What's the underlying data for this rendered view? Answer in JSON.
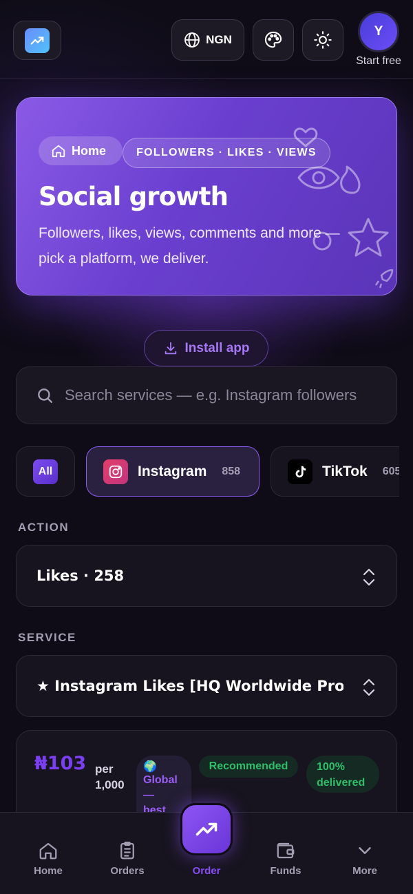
{
  "header": {
    "currency_label": "NGN",
    "avatar_initial": "Y",
    "avatar_caption": "Start free"
  },
  "hero": {
    "home_chip": "Home",
    "tags": "FOLLOWERS · LIKES · VIEWS",
    "title": "Social growth",
    "subtitle": "Followers, likes, views, comments and more — pick a platform, we deliver."
  },
  "install_label": "Install app",
  "search": {
    "placeholder": "Search services — e.g. Instagram followers"
  },
  "platforms": [
    {
      "name": "All",
      "selected": false
    },
    {
      "name": "Instagram",
      "count": "858",
      "selected": true
    },
    {
      "name": "TikTok",
      "count": "605",
      "selected": false
    }
  ],
  "action": {
    "label": "ACTION",
    "value": "Likes · 258"
  },
  "service": {
    "label": "SERVICE",
    "value": "★ Instagram Likes [HQ Worldwide Profiles]"
  },
  "service_card": {
    "price": "₦103",
    "per_line1": "per",
    "per_line2": "1,000",
    "global_line1": "Global",
    "global_line2": "—",
    "global_line3": "best",
    "recommended": "Recommended",
    "delivered_line1": "100%",
    "delivered_line2": "delivered"
  },
  "nav": {
    "home": "Home",
    "orders": "Orders",
    "order": "Order",
    "funds": "Funds",
    "more": "More"
  },
  "colors": {
    "accent": "#8a4ff5",
    "success": "#2fbf6a",
    "background": "#0f0c17"
  }
}
